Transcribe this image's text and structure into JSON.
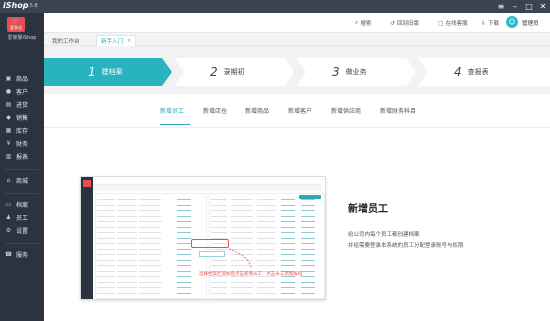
{
  "titlebar": {
    "brand": "iShop",
    "version": "1.5.8"
  },
  "sidebar": {
    "logo_text": "爱多店",
    "shop_name": "爱家婴iShop",
    "items": [
      {
        "label": "商品",
        "icon": "goods-icon"
      },
      {
        "label": "客户",
        "icon": "customer-icon"
      },
      {
        "label": "进货",
        "icon": "purchase-icon"
      },
      {
        "label": "销售",
        "icon": "sales-icon"
      },
      {
        "label": "库存",
        "icon": "inventory-icon"
      },
      {
        "label": "财务",
        "icon": "finance-icon"
      },
      {
        "label": "报表",
        "icon": "report-icon"
      },
      {
        "label": "商城",
        "icon": "mall-icon"
      },
      {
        "label": "档案",
        "icon": "archive-icon"
      },
      {
        "label": "员工",
        "icon": "staff-icon"
      },
      {
        "label": "设置",
        "icon": "settings-icon"
      },
      {
        "label": "服务",
        "icon": "service-icon"
      }
    ]
  },
  "header": {
    "search": "搜索",
    "back_old": "回到旧版",
    "online_service": "在线客服",
    "download": "下载",
    "username": "管理员"
  },
  "tabs": [
    {
      "label": "我的工作台"
    },
    {
      "label": "新手入门",
      "close": "×"
    }
  ],
  "steps": [
    {
      "num": "1",
      "label": "建档案",
      "active": true
    },
    {
      "num": "2",
      "label": "录期初",
      "active": false
    },
    {
      "num": "3",
      "label": "做业务",
      "active": false
    },
    {
      "num": "4",
      "label": "查报表",
      "active": false
    }
  ],
  "subtabs": [
    "新增员工",
    "新增店仓",
    "新增商品",
    "新增客户",
    "新增供应商",
    "新增财务科目"
  ],
  "content": {
    "title": "新增员工",
    "line1": "给公司内每个员工都创建档案",
    "line2": "并给需要登录本系统的员工分配登录账号与权限"
  },
  "mock": {
    "callout": "选择档案栏添加后点击新增员工 · 点击员工添加按钮",
    "button": "+ 新增员工",
    "popup": "新增员工"
  },
  "colors": {
    "accent": "#2aa8b7",
    "sidebar": "#2b3340",
    "brand_red": "#e84d55"
  }
}
